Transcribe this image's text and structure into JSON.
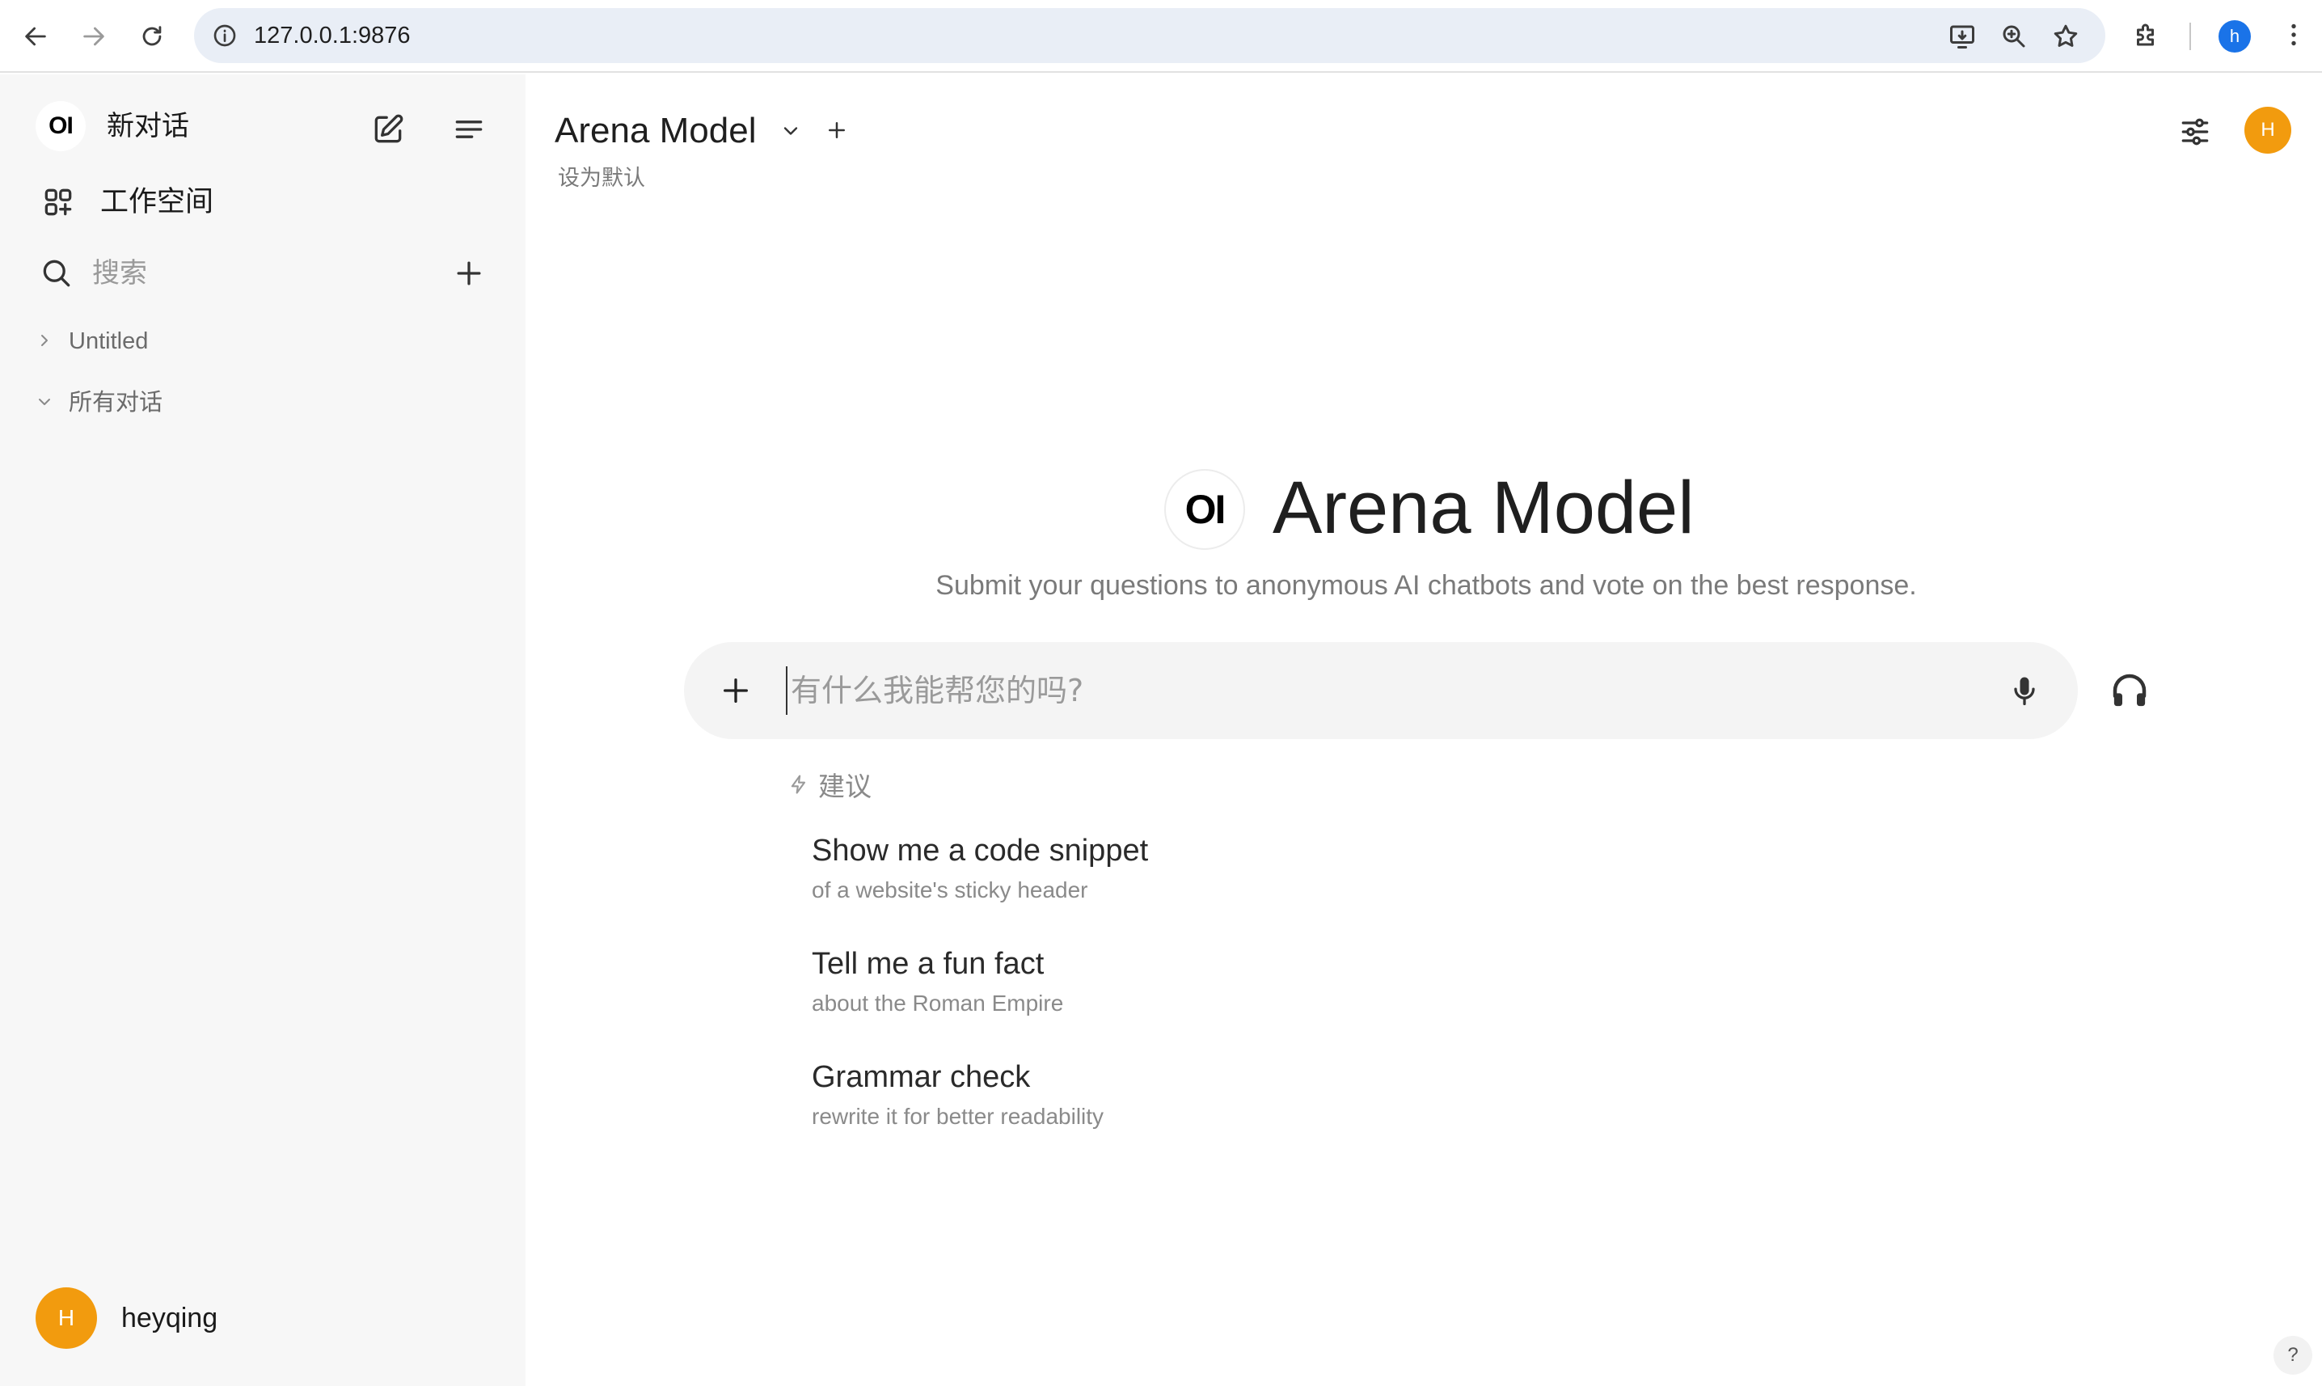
{
  "browser": {
    "url": "127.0.0.1:9876",
    "profile_initial": "h"
  },
  "sidebar": {
    "brand_logo": "OI",
    "new_chat_label": "新对话",
    "workspace_label": "工作空间",
    "search_placeholder": "搜索",
    "folders": [
      {
        "label": "Untitled",
        "expanded": false
      },
      {
        "label": "所有对话",
        "expanded": true
      }
    ],
    "user": {
      "initial": "H",
      "name": "heyqing"
    }
  },
  "header": {
    "model_name": "Arena Model",
    "set_default_label": "设为默认",
    "avatar_initial": "H"
  },
  "hero": {
    "logo": "OI",
    "title": "Arena Model",
    "subtitle": "Submit your questions to anonymous AI chatbots and vote on the best response."
  },
  "chat": {
    "placeholder": "有什么我能帮您的吗?"
  },
  "suggestions": {
    "heading": "建议",
    "items": [
      {
        "title": "Show me a code snippet",
        "subtitle": "of a website's sticky header"
      },
      {
        "title": "Tell me a fun fact",
        "subtitle": "about the Roman Empire"
      },
      {
        "title": "Grammar check",
        "subtitle": "rewrite it for better readability"
      }
    ]
  },
  "help_label": "?",
  "colors": {
    "accent_avatar": "#f29b0e",
    "sidebar_bg": "#f7f7f7",
    "chat_box_bg": "#f4f4f4"
  },
  "icons": [
    "back-arrow-icon",
    "forward-arrow-icon",
    "reload-icon",
    "site-info-icon",
    "install-app-icon",
    "zoom-icon",
    "star-icon",
    "extensions-icon",
    "kebab-menu-icon",
    "edit-icon",
    "menu-icon",
    "workspace-icon",
    "search-icon",
    "plus-icon",
    "chevron-right-icon",
    "chevron-down-icon",
    "sliders-icon",
    "microphone-icon",
    "headphones-icon",
    "lightning-icon"
  ]
}
